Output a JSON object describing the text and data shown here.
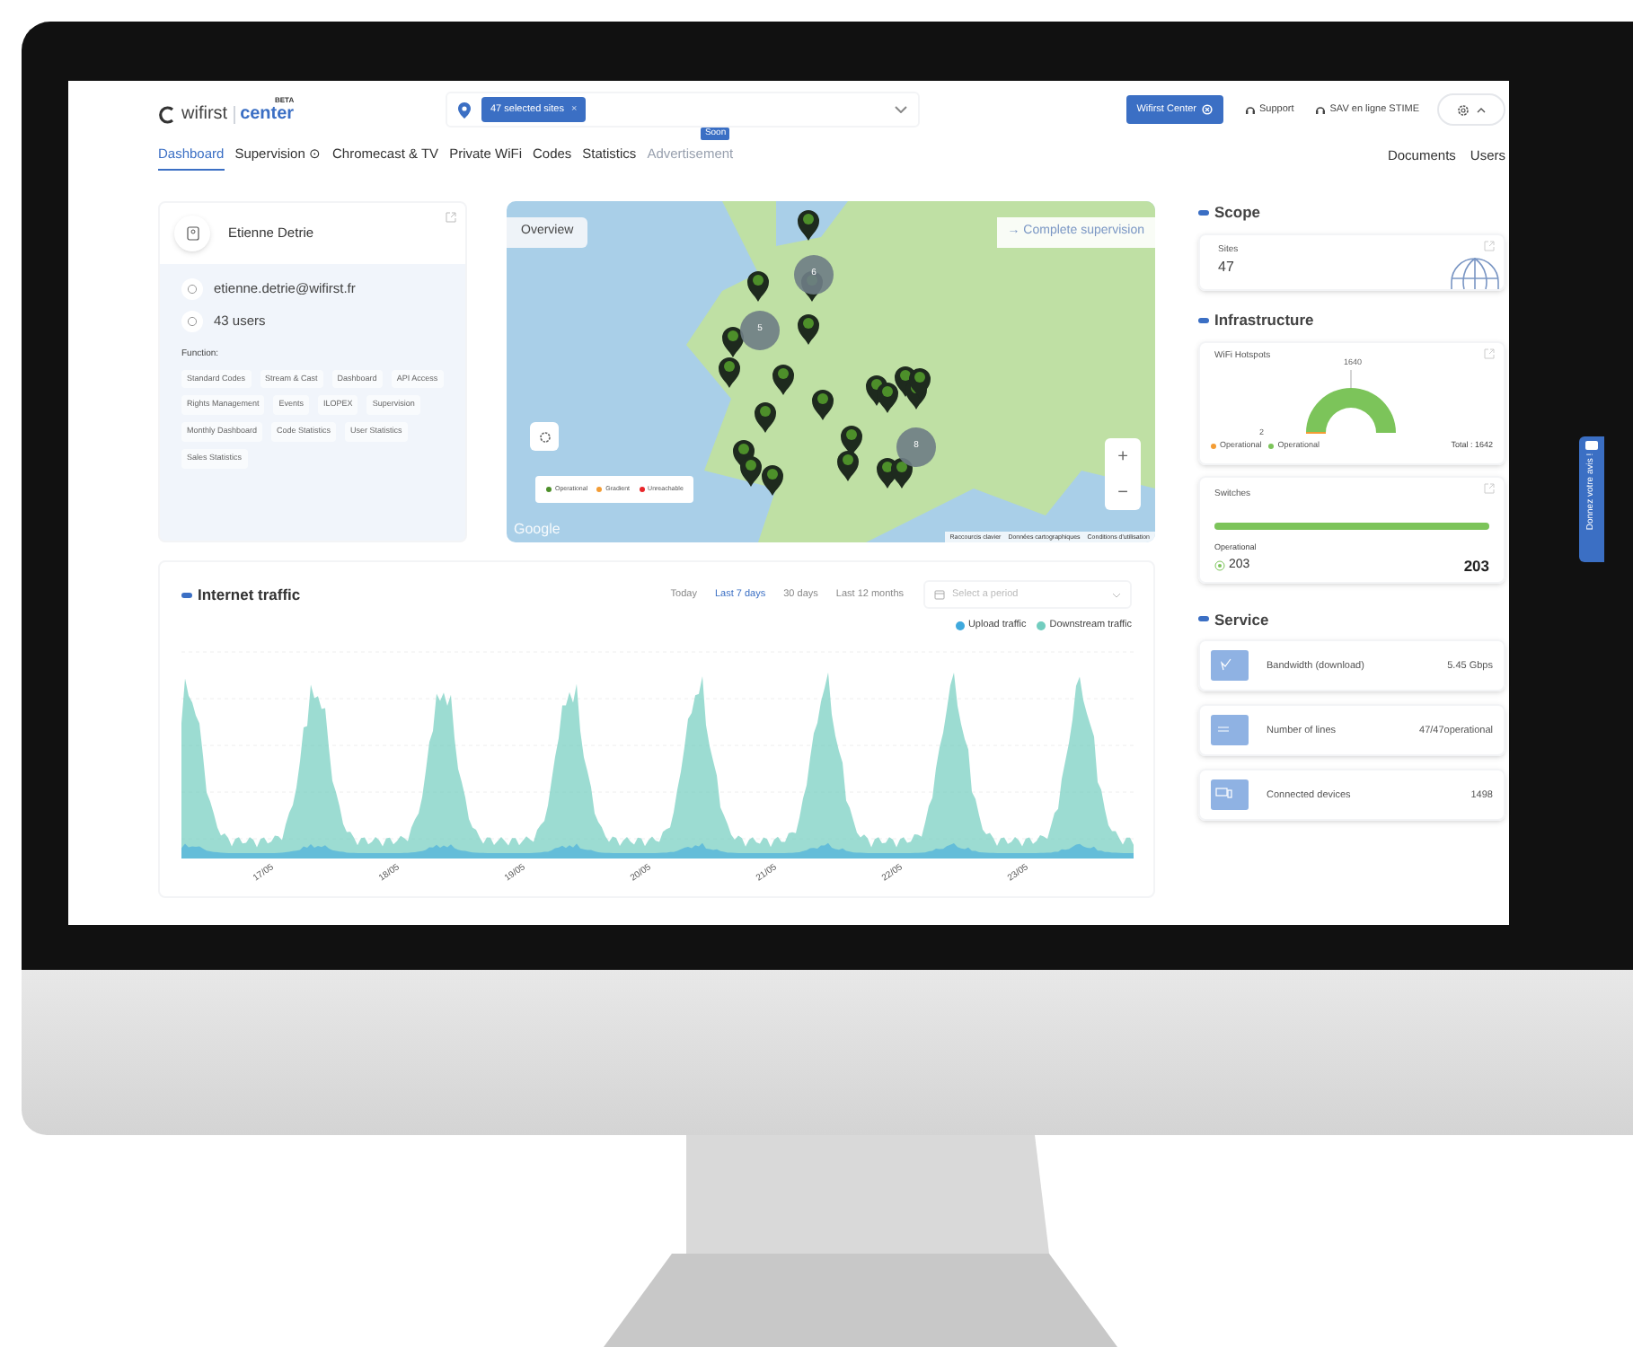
{
  "header": {
    "logo": {
      "brand": "wifirst",
      "product": "center",
      "badge": "BETA"
    },
    "site_filter": {
      "chip": "47 selected sites",
      "chip_close": "×"
    },
    "center_button": "Wifirst Center",
    "links": [
      "Support",
      "SAV en ligne STIME"
    ]
  },
  "nav": {
    "tabs": [
      {
        "label": "Dashboard",
        "selected": true,
        "disabled": false
      },
      {
        "label": "Supervision",
        "selected": false,
        "disabled": false,
        "suffix": "⊙"
      },
      {
        "label": "Chromecast & TV",
        "selected": false,
        "disabled": false
      },
      {
        "label": "Private WiFi",
        "selected": false,
        "disabled": false
      },
      {
        "label": "Codes",
        "selected": false,
        "disabled": false
      },
      {
        "label": "Statistics",
        "selected": false,
        "disabled": false
      },
      {
        "label": "Advertisement",
        "selected": false,
        "disabled": true,
        "badge": "Soon"
      }
    ],
    "right_links": [
      "Documents",
      "Users"
    ]
  },
  "profile": {
    "name": "Etienne Detrie",
    "email": "etienne.detrie@wifirst.fr",
    "users": "43 users",
    "function_label": "Function:",
    "functions": [
      "Standard Codes",
      "Stream & Cast",
      "Dashboard",
      "API Access",
      "Rights Management",
      "Events",
      "ILOPEX",
      "Supervision",
      "Monthly Dashboard",
      "Code Statistics",
      "User Statistics",
      "Sales Statistics"
    ]
  },
  "map": {
    "title": "Overview",
    "link": "→ Complete supervision",
    "clusters": [
      "6",
      "5",
      "8"
    ],
    "zoom": [
      "+",
      "−"
    ],
    "google": "Google",
    "legend": [
      {
        "label": "Operational",
        "color": "#4d8f2a"
      },
      {
        "label": "Gradient",
        "color": "#f39c34"
      },
      {
        "label": "Unreachable",
        "color": "#e8262a"
      }
    ],
    "attribution": [
      "Raccourcis clavier",
      "Données cartographiques",
      "Conditions d'utilisation"
    ]
  },
  "traffic": {
    "title": "Internet traffic",
    "period_placeholder": "Select a period",
    "periods": [
      {
        "label": "Today",
        "selected": false
      },
      {
        "label": "Last 7 days",
        "selected": true
      },
      {
        "label": "30 days",
        "selected": false
      },
      {
        "label": "Last 12 months",
        "selected": false
      }
    ],
    "legend": [
      {
        "label": "Upload traffic",
        "color": "#3fa9dd"
      },
      {
        "label": "Downstream traffic",
        "color": "#72cdbf"
      }
    ],
    "x_labels": [
      "17/05",
      "18/05",
      "19/05",
      "20/05",
      "21/05",
      "22/05",
      "23/05"
    ]
  },
  "scope": {
    "title": "Scope",
    "sites_label": "Sites",
    "sites_value": "47"
  },
  "infrastructure": {
    "title": "Infrastructure",
    "hotspots": {
      "label": "WiFi Hotspots",
      "top_value": "1640",
      "low_value": "2",
      "total": "Total : 1642",
      "legend": [
        {
          "label": "Operational",
          "color": "#f39c34"
        },
        {
          "label": "Operational",
          "color": "#7cc45a"
        }
      ]
    },
    "switches": {
      "label": "Switches",
      "level": 1,
      "status_label": "Operational",
      "count": "203",
      "total": "203"
    }
  },
  "service": {
    "title": "Service",
    "items": [
      {
        "kind": "chart",
        "label": "Bandwidth (download)",
        "value": "5.45 Gbps"
      },
      {
        "kind": "lines",
        "label": "Number of lines",
        "value": "47/47operational"
      },
      {
        "kind": "devices",
        "label": "Connected devices",
        "value": "1498"
      }
    ]
  },
  "feedback_tab": "Donnez votre avis !"
}
